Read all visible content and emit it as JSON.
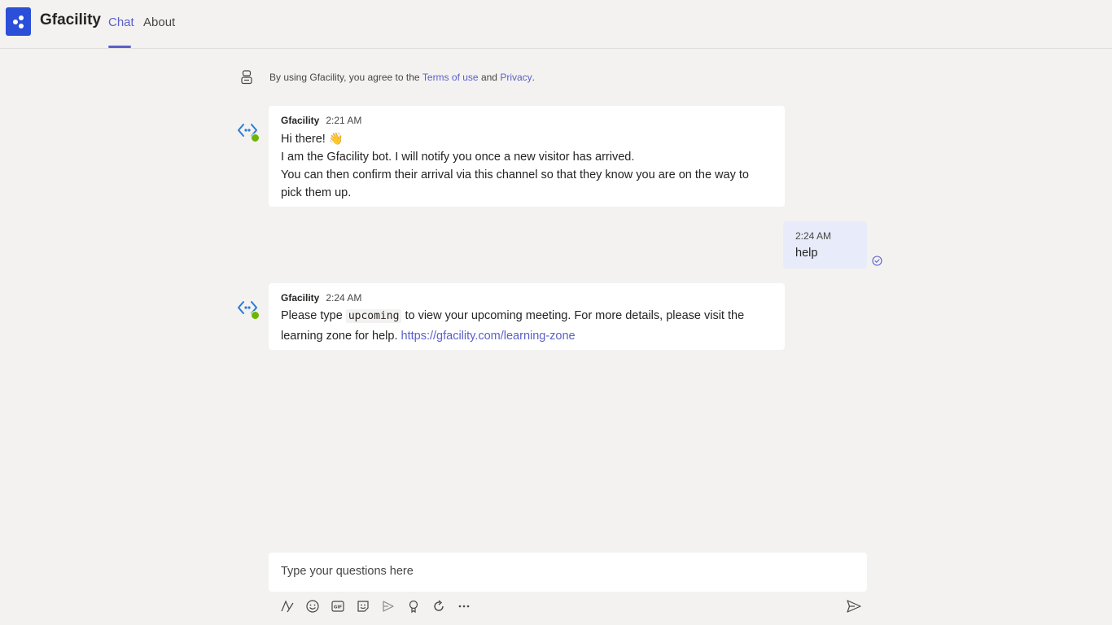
{
  "header": {
    "app_name": "Gfacility",
    "tabs": [
      {
        "label": "Chat",
        "active": true
      },
      {
        "label": "About",
        "active": false
      }
    ],
    "accent_color": "#5b5fc7",
    "logo_color": "#2b4fd8"
  },
  "consent": {
    "prefix": "By using Gfacility, you agree to the ",
    "terms_link": "Terms of use",
    "middle": " and ",
    "privacy_link": "Privacy",
    "suffix": "."
  },
  "messages": [
    {
      "sender": "Gfacility",
      "time": "2:21 AM",
      "line1": "Hi there! 👋",
      "line2": "I am the Gfacility bot. I will notify you once a new visitor has arrived.",
      "line3": "You can then confirm their arrival via this channel so that they know you are on the way to pick them up."
    },
    {
      "time": "2:24 AM",
      "text": "help"
    },
    {
      "sender": "Gfacility",
      "time": "2:24 AM",
      "text_before": "Please type ",
      "code": "upcoming",
      "text_after": " to view your upcoming meeting. For more details, please visit the learning zone for help. ",
      "link": "https://gfacility.com/learning-zone"
    }
  ],
  "compose": {
    "placeholder": "Type your questions here"
  },
  "toolbar_icons": [
    "format-icon",
    "emoji-icon",
    "gif-icon",
    "sticker-icon",
    "schedule-meeting-icon",
    "praise-icon",
    "loop-icon",
    "more-options-icon"
  ],
  "send_icon": "send-icon"
}
